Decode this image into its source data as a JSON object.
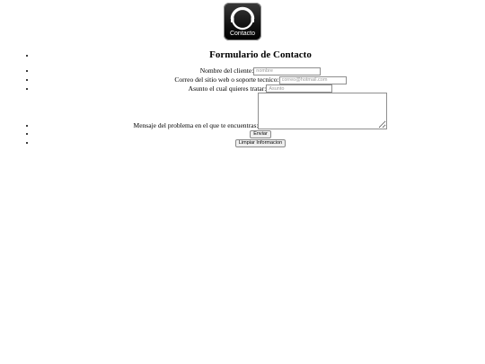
{
  "logo": {
    "label": "Contacto",
    "icon": "headset-icon"
  },
  "form": {
    "title": "Formulario de Contacto",
    "fields": {
      "name": {
        "label": "Nombre del cliente:",
        "placeholder": "nombre",
        "value": ""
      },
      "email": {
        "label": "Correo del sitio web o soporte tecnico:",
        "placeholder": "correo@hotmail.com",
        "value": ""
      },
      "subject": {
        "label": "Asunto el cual quieres tratar:",
        "placeholder": "Asunto",
        "value": ""
      },
      "message": {
        "label": "Mensaje del problema en el que te encuentras:",
        "value": ""
      }
    },
    "submit_label": "Enviar",
    "clear_label": "Limpiar Informacion"
  }
}
